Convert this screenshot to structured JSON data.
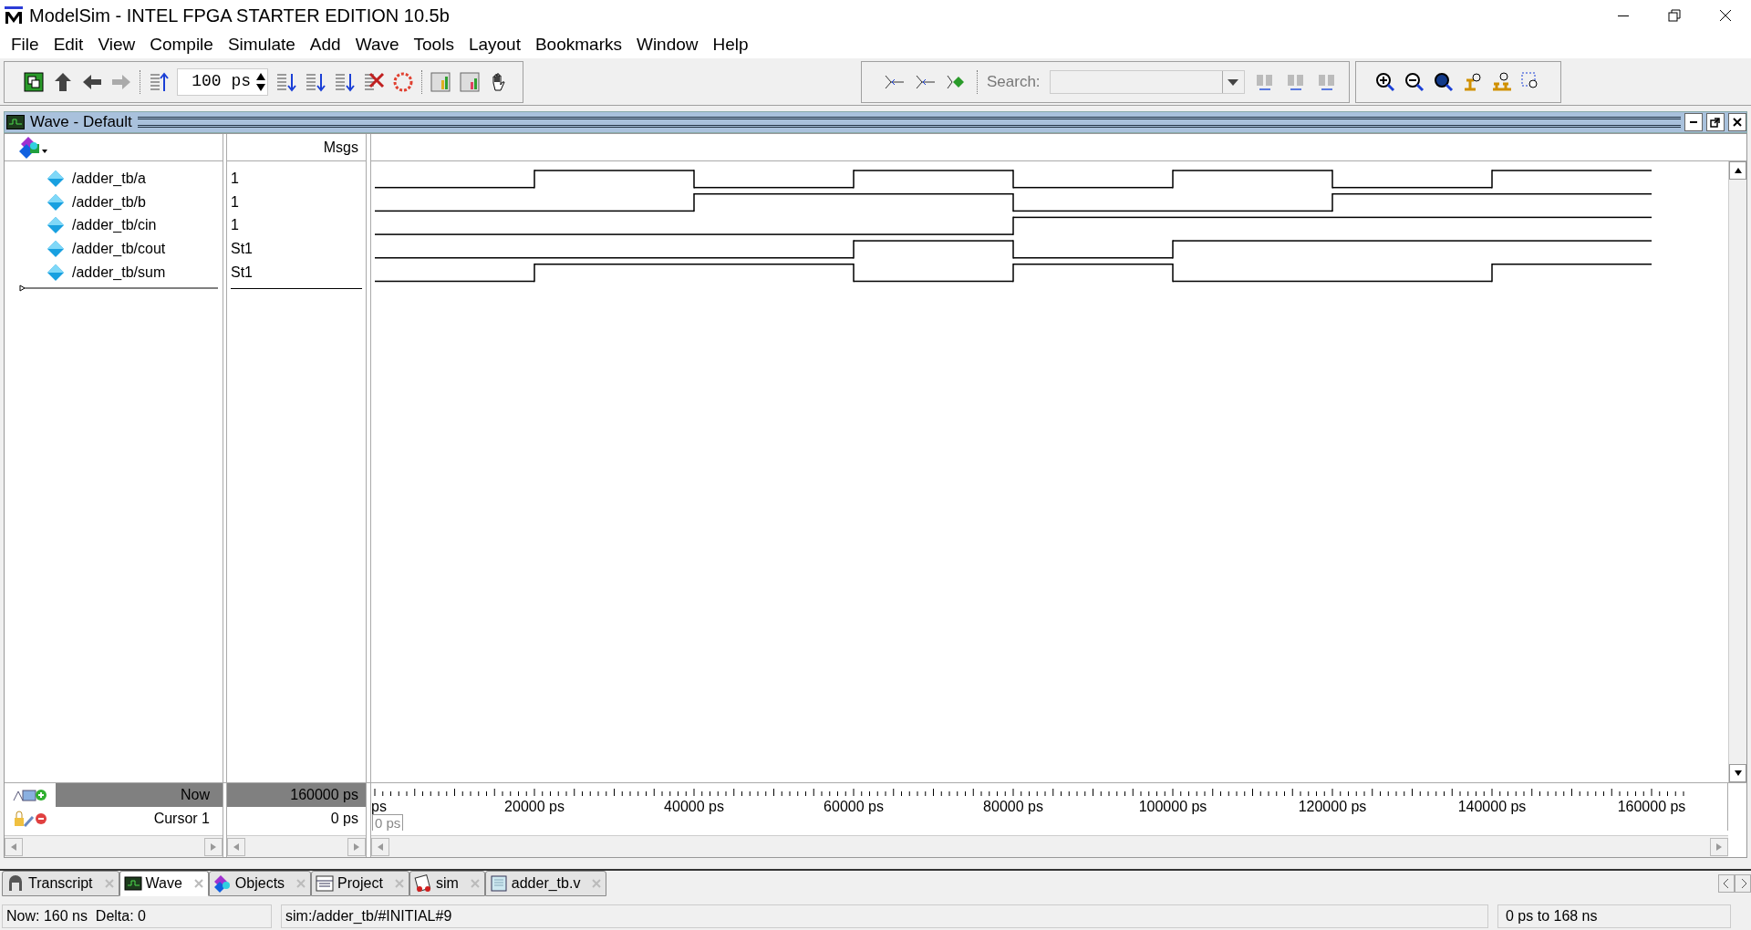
{
  "window": {
    "title": "ModelSim - INTEL FPGA STARTER EDITION 10.5b"
  },
  "menu": [
    "File",
    "Edit",
    "View",
    "Compile",
    "Simulate",
    "Add",
    "Wave",
    "Tools",
    "Layout",
    "Bookmarks",
    "Window",
    "Help"
  ],
  "toolbar": {
    "run_length": "100 ps",
    "search_label": "Search:"
  },
  "wave_window": {
    "title": "Wave - Default",
    "msgs_header": "Msgs",
    "signals": [
      {
        "name": "/adder_tb/a",
        "value": "1",
        "high": [
          false,
          true,
          false,
          true,
          false,
          true,
          false,
          true
        ]
      },
      {
        "name": "/adder_tb/b",
        "value": "1",
        "high": [
          false,
          false,
          true,
          true,
          false,
          false,
          true,
          true
        ]
      },
      {
        "name": "/adder_tb/cin",
        "value": "1",
        "high": [
          false,
          false,
          false,
          false,
          true,
          true,
          true,
          true
        ]
      },
      {
        "name": "/adder_tb/cout",
        "value": "St1",
        "high": [
          false,
          false,
          false,
          true,
          false,
          true,
          true,
          true
        ]
      },
      {
        "name": "/adder_tb/sum",
        "value": "St1",
        "high": [
          false,
          true,
          true,
          false,
          true,
          false,
          false,
          true
        ]
      }
    ],
    "now_label": "Now",
    "now_value": "160000 ps",
    "cursor_label": "Cursor 1",
    "cursor_value": "0 ps",
    "cursor_flag": "0 ps",
    "time_labels": [
      "ps",
      "20000 ps",
      "40000 ps",
      "60000 ps",
      "80000 ps",
      "100000 ps",
      "120000 ps",
      "140000 ps",
      "160000 ps"
    ]
  },
  "tabs": [
    {
      "label": "Transcript",
      "selected": false
    },
    {
      "label": "Wave",
      "selected": true
    },
    {
      "label": "Objects",
      "selected": false
    },
    {
      "label": "Project",
      "selected": false
    },
    {
      "label": "sim",
      "selected": false
    },
    {
      "label": "adder_tb.v",
      "selected": false
    }
  ],
  "status_bar": {
    "now": "Now: 160 ns  Delta: 0",
    "context": "sim:/adder_tb/#INITIAL#9",
    "range": "0 ps to 168 ns"
  }
}
